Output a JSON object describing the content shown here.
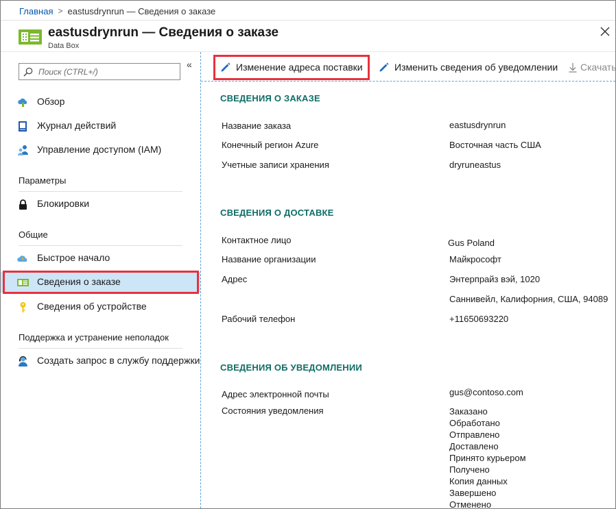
{
  "breadcrumb": {
    "home": "Главная",
    "separator": ">",
    "current": "eastusdrynrun — Сведения о заказе"
  },
  "header": {
    "title": "eastusdrynrun — Сведения о заказе",
    "subtitle": "Data Box",
    "close_icon": "close-icon"
  },
  "sidebar": {
    "search_placeholder": "Поиск (CTRL+/)",
    "collapse_glyph": "«",
    "top_items": [
      {
        "label": "Обзор",
        "icon": "overview-icon"
      },
      {
        "label": "Журнал действий",
        "icon": "activity-log-icon"
      },
      {
        "label": "Управление доступом (IAM)",
        "icon": "iam-icon"
      }
    ],
    "section_params": "Параметры",
    "params_items": [
      {
        "label": "Блокировки",
        "icon": "lock-icon"
      }
    ],
    "section_general": "Общие",
    "general_items": [
      {
        "label": "Быстрое начало",
        "icon": "quickstart-icon"
      },
      {
        "label": "Сведения о заказе",
        "icon": "order-details-icon"
      },
      {
        "label": "Сведения об устройстве",
        "icon": "key-icon"
      }
    ],
    "section_support": "Поддержка и устранение неполадок",
    "support_items": [
      {
        "label": "Создать запрос в службу поддержки",
        "icon": "support-icon"
      }
    ]
  },
  "toolbar": {
    "edit_shipping": "Изменение адреса поставки",
    "edit_notification": "Изменить сведения об уведомлении",
    "download": "Скачать"
  },
  "order": {
    "title": "СВЕДЕНИЯ О ЗАКАЗЕ",
    "rows": [
      {
        "label": "Название заказа",
        "value": "eastusdrynrun"
      },
      {
        "label": "Конечный регион Azure",
        "value": "Восточная часть США"
      },
      {
        "label": "Учетные записи хранения",
        "value": "dryruneastus"
      }
    ]
  },
  "shipping": {
    "title": "СВЕДЕНИЯ О ДОСТАВКЕ",
    "contact_label": "Контактное лицо",
    "contact_value": "Gus Poland",
    "company_label": "Название организации",
    "company_value": "Майкрософт",
    "address_label": "Адрес",
    "address_line1": "Энтерпрайз вэй, 1020",
    "address_line2": "Саннивейл, Калифорния, США, 94089",
    "phone_label": "Рабочий телефон",
    "phone_value": "+11650693220"
  },
  "notification": {
    "title": "СВЕДЕНИЯ ОБ УВЕДОМЛЕНИИ",
    "email_label": "Адрес электронной почты",
    "email_value": "gus@contoso.com",
    "status_label": "Состояния уведомления",
    "statuses": [
      "Заказано",
      "Обработано",
      "Отправлено",
      "Доставлено",
      "Принято курьером",
      "Получено",
      "Копия данных",
      "Завершено",
      "Отменено"
    ]
  },
  "colors": {
    "link": "#0058ad",
    "section_title": "#0f6d66",
    "highlight_border": "#e8303e",
    "selected_bg": "#cde6f7",
    "accent_blue": "#1f6fc5"
  }
}
